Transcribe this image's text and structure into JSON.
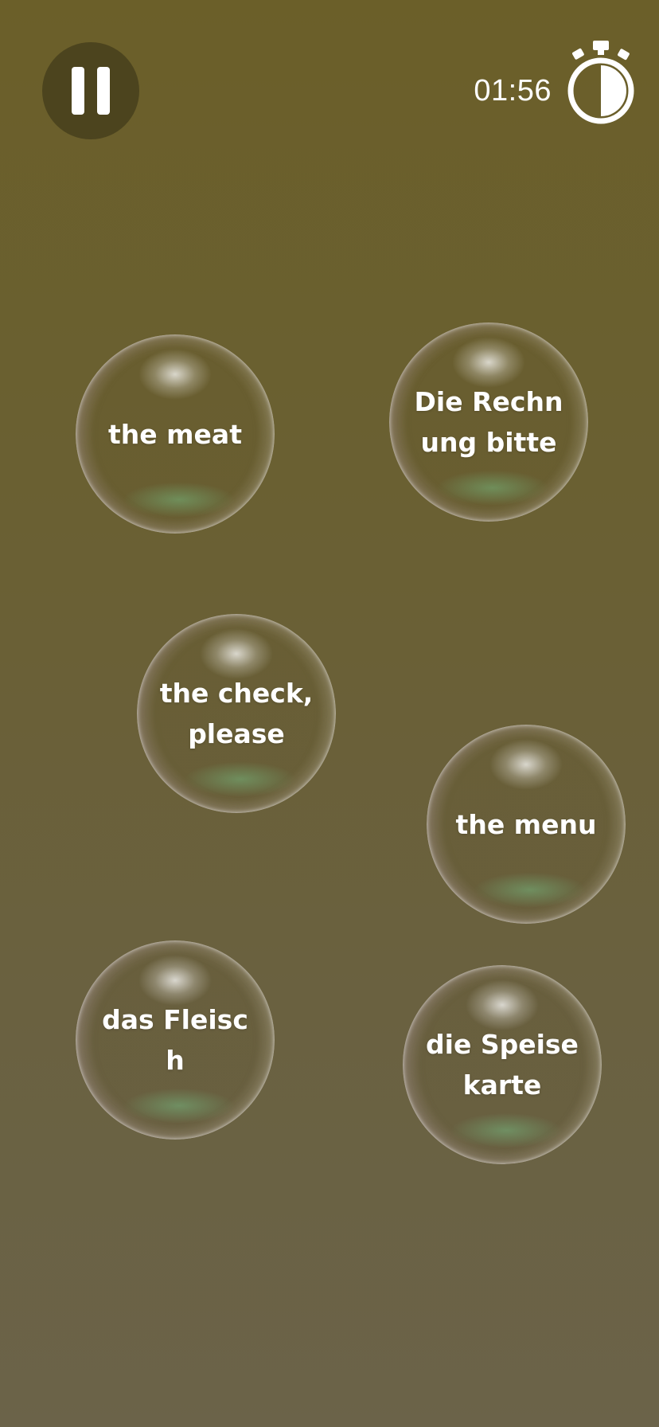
{
  "hud": {
    "pause_icon": "pause-icon",
    "timer": "01:56",
    "stopwatch_icon": "stopwatch-icon",
    "stopwatch_elapsed_fraction": 0.5
  },
  "bubbles": [
    {
      "label": "the meat",
      "lang": "English"
    },
    {
      "label": "Die Rechnung bitte",
      "lang": "German"
    },
    {
      "label": "the check, please",
      "lang": "English"
    },
    {
      "label": "the menu",
      "lang": "English"
    },
    {
      "label": "das Fleisch",
      "lang": "German"
    },
    {
      "label": "die Speisekarte",
      "lang": "German"
    }
  ],
  "colors": {
    "background_top": "#6b5f29",
    "background_bottom": "#6b6349",
    "text": "#ffffff"
  }
}
